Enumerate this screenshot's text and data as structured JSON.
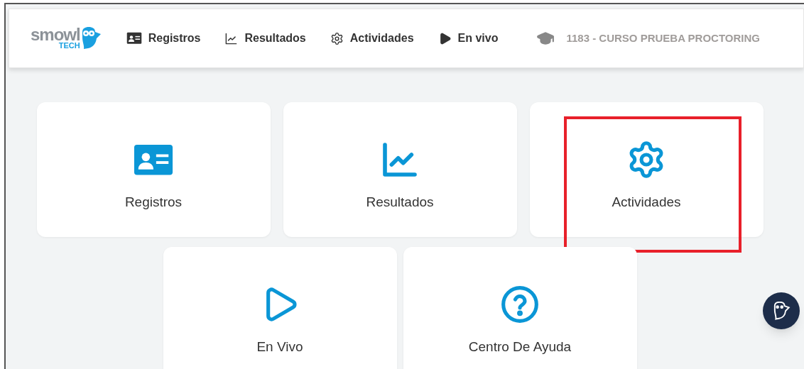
{
  "logo": {
    "name": "smowl",
    "sub": "TECH"
  },
  "nav": [
    {
      "label": "Registros",
      "kind": "id"
    },
    {
      "label": "Resultados",
      "kind": "chart"
    },
    {
      "label": "Actividades",
      "kind": "gear"
    },
    {
      "label": "En vivo",
      "kind": "play"
    }
  ],
  "course": "1183 - CURSO PRUEBA PROCTORING",
  "cards": [
    {
      "label": "Registros",
      "kind": "id",
      "highlighted": false
    },
    {
      "label": "Resultados",
      "kind": "chart",
      "highlighted": false
    },
    {
      "label": "Actividades",
      "kind": "gear",
      "highlighted": true
    },
    {
      "label": "En Vivo",
      "kind": "play",
      "highlighted": false
    },
    {
      "label": "Centro De Ayuda",
      "kind": "help",
      "highlighted": false
    }
  ]
}
